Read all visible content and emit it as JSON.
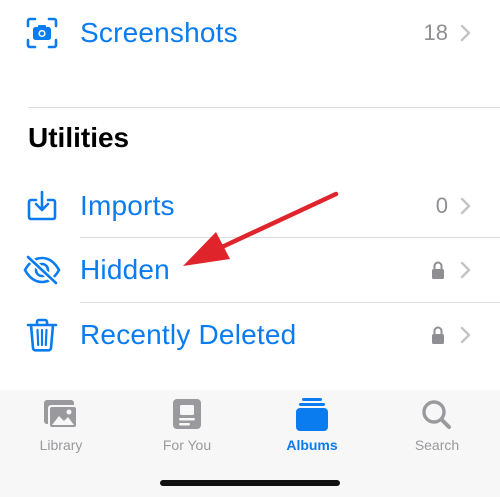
{
  "albums": {
    "screenshots": {
      "label": "Screenshots",
      "count": "18"
    }
  },
  "utilities": {
    "title": "Utilities",
    "items": [
      {
        "label": "Imports",
        "count": "0",
        "icon": "import-icon"
      },
      {
        "label": "Hidden",
        "icon": "hidden-eye-icon",
        "locked": true
      },
      {
        "label": "Recently Deleted",
        "icon": "trash-icon",
        "locked": true
      }
    ]
  },
  "tabbar": {
    "tabs": [
      {
        "label": "Library",
        "icon": "library-icon",
        "active": false
      },
      {
        "label": "For You",
        "icon": "for-you-icon",
        "active": false
      },
      {
        "label": "Albums",
        "icon": "albums-icon",
        "active": true
      },
      {
        "label": "Search",
        "icon": "search-icon",
        "active": false
      }
    ]
  },
  "colors": {
    "accent": "#0a7cf0",
    "secondary_text": "#8e8e93",
    "annotation_arrow": "#e0242b"
  }
}
